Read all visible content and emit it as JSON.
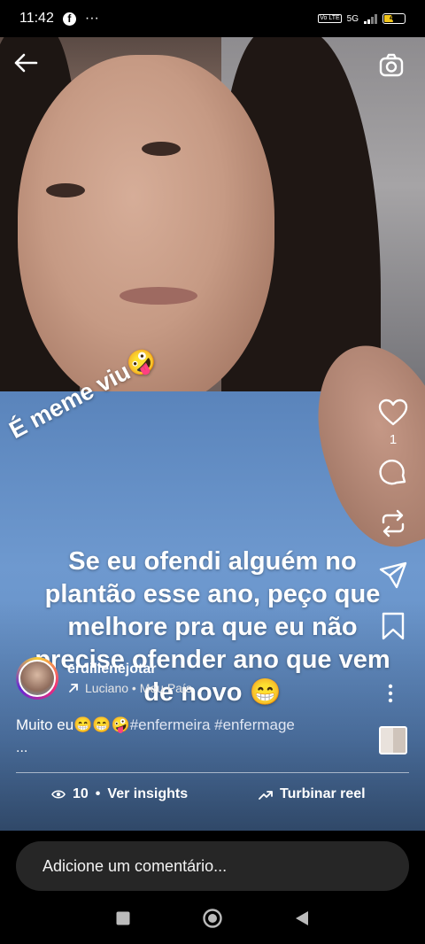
{
  "status": {
    "time": "11:42",
    "more": "···",
    "network": "5G",
    "battery": "40",
    "volte": "Vo LTE"
  },
  "reel": {
    "sticker_text": "É meme viu🤪",
    "caption": "Se eu ofendi alguém no plantão esse ano, peço que melhore  pra que eu não precise ofender ano que vem de novo 😁",
    "likes": "1",
    "author": {
      "username": "erdilienejotar",
      "audio": "Luciano • Meu País"
    },
    "description": {
      "text": "Muito eu😁😁🤪",
      "hashtags": "#enfermeira #enfermage",
      "more": "..."
    },
    "insights": {
      "views": "10",
      "label": "Ver insights"
    },
    "boost_label": "Turbinar reel"
  },
  "comment": {
    "placeholder": "Adicione um comentário..."
  },
  "icons": [
    "back-arrow-icon",
    "camera-icon",
    "heart-icon",
    "comment-icon",
    "repost-icon",
    "send-icon",
    "bookmark-icon",
    "more-icon",
    "eye-icon",
    "trend-icon",
    "audio-arrow-icon",
    "home-circle-icon",
    "recents-square-icon",
    "back-triangle-icon",
    "facebook-icon",
    "battery-icon",
    "signal-icon"
  ]
}
